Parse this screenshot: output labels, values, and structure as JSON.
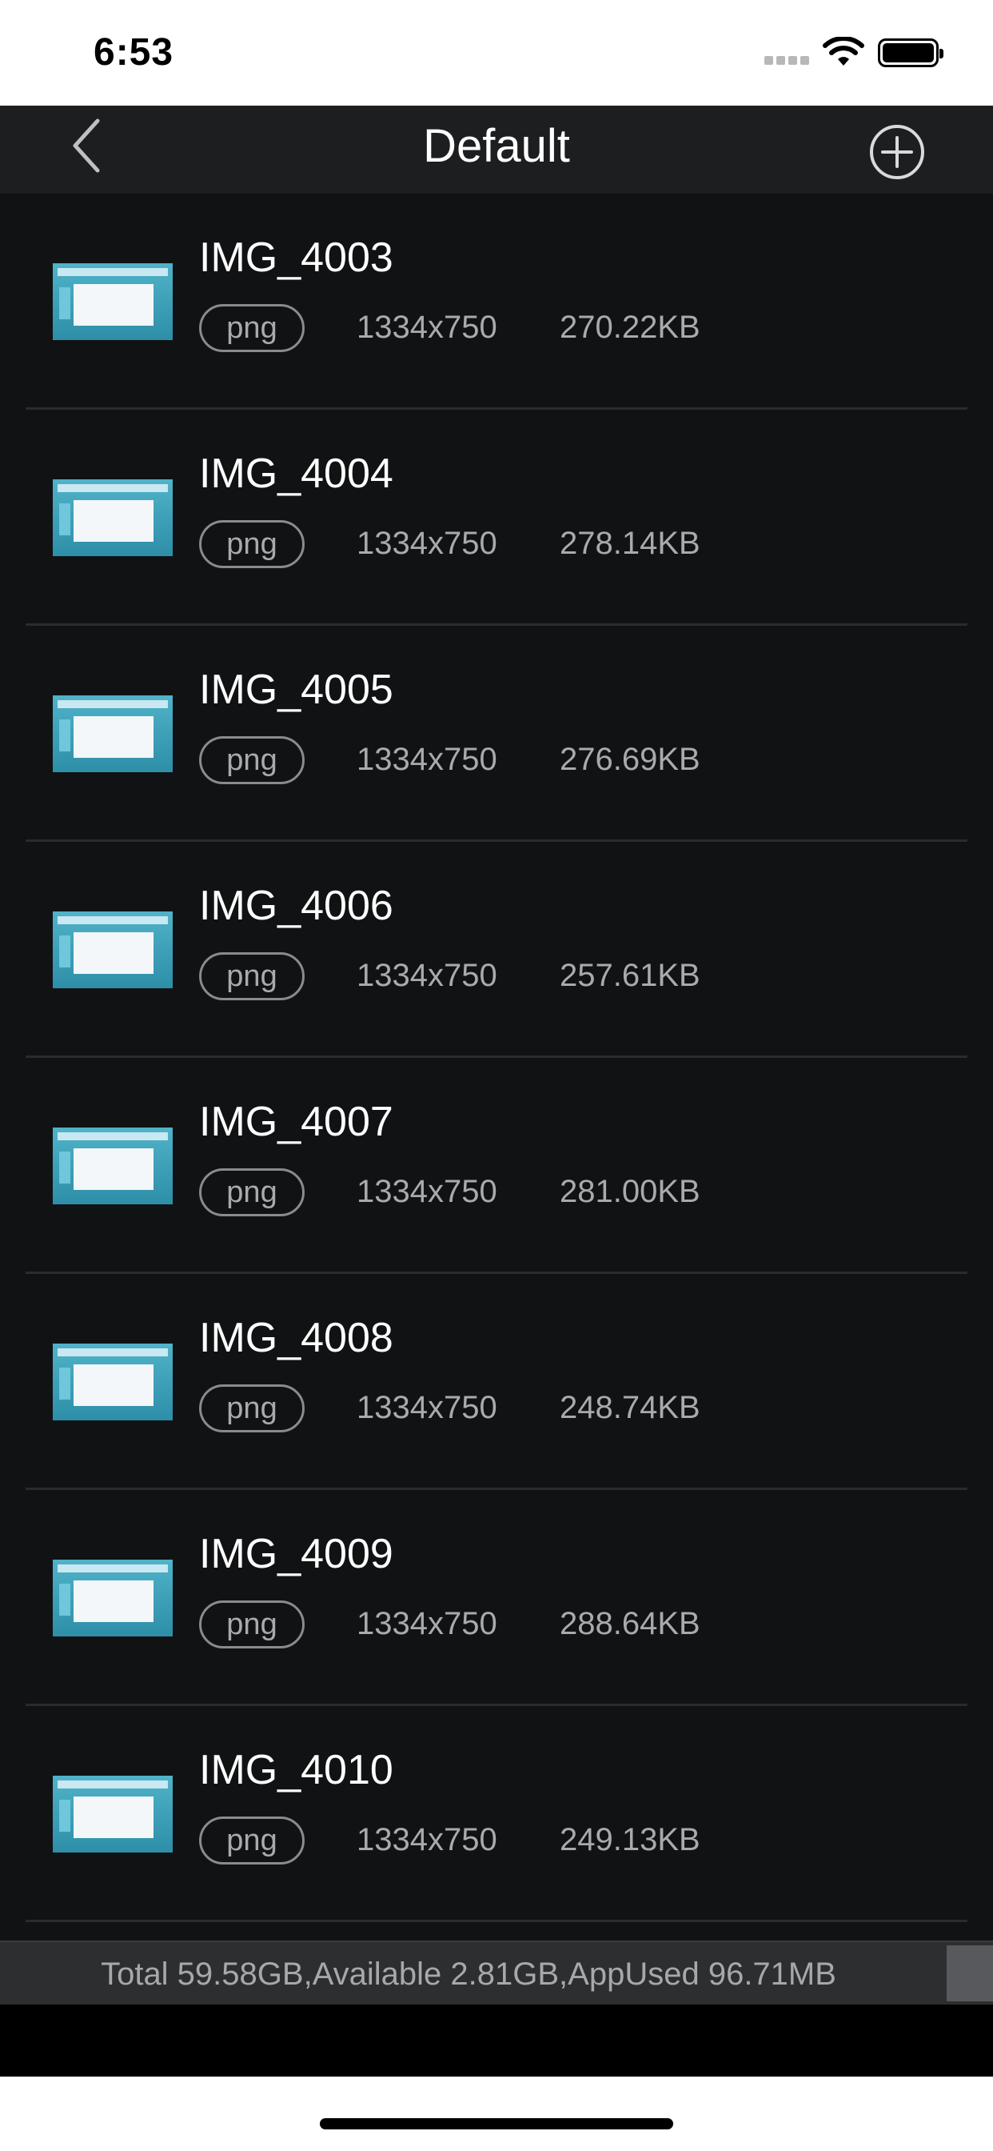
{
  "status_bar": {
    "time": "6:53"
  },
  "nav": {
    "title": "Default",
    "back_icon": "chevron-left-icon",
    "add_icon": "plus-circle-icon"
  },
  "files": [
    {
      "name": "IMG_4003",
      "type": "png",
      "dimensions": "1334x750",
      "size": "270.22KB"
    },
    {
      "name": "IMG_4004",
      "type": "png",
      "dimensions": "1334x750",
      "size": "278.14KB"
    },
    {
      "name": "IMG_4005",
      "type": "png",
      "dimensions": "1334x750",
      "size": "276.69KB"
    },
    {
      "name": "IMG_4006",
      "type": "png",
      "dimensions": "1334x750",
      "size": "257.61KB"
    },
    {
      "name": "IMG_4007",
      "type": "png",
      "dimensions": "1334x750",
      "size": "281.00KB"
    },
    {
      "name": "IMG_4008",
      "type": "png",
      "dimensions": "1334x750",
      "size": "248.74KB"
    },
    {
      "name": "IMG_4009",
      "type": "png",
      "dimensions": "1334x750",
      "size": "288.64KB"
    },
    {
      "name": "IMG_4010",
      "type": "png",
      "dimensions": "1334x750",
      "size": "249.13KB"
    }
  ],
  "footer": {
    "storage": "Total 59.58GB,Available 2.81GB,AppUsed 96.71MB"
  }
}
